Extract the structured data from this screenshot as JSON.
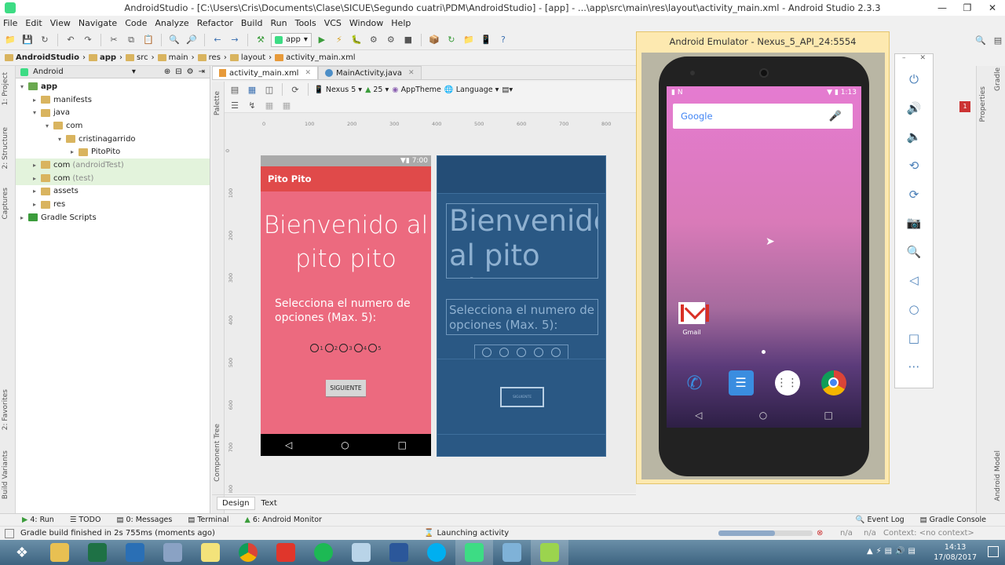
{
  "window": {
    "title": "AndroidStudio - [C:\\Users\\Cris\\Documents\\Clase\\SICUE\\Segundo cuatri\\PDM\\AndroidStudio] - [app] - ...\\app\\src\\main\\res\\layout\\activity_main.xml - Android Studio 2.3.3"
  },
  "menu": [
    "File",
    "Edit",
    "View",
    "Navigate",
    "Code",
    "Analyze",
    "Refactor",
    "Build",
    "Run",
    "Tools",
    "VCS",
    "Window",
    "Help"
  ],
  "toolbar": {
    "run_config": "app"
  },
  "breadcrumb": [
    "AndroidStudio",
    "app",
    "src",
    "main",
    "res",
    "layout",
    "activity_main.xml"
  ],
  "project": {
    "view_mode": "Android",
    "tree": [
      {
        "label": "app",
        "depth": 0,
        "open": true,
        "color": "#6aa84f"
      },
      {
        "label": "manifests",
        "depth": 1,
        "open": false,
        "color": "#d9b45f"
      },
      {
        "label": "java",
        "depth": 1,
        "open": true,
        "color": "#d9b45f"
      },
      {
        "label": "com",
        "depth": 2,
        "open": true,
        "color": "#d9b45f"
      },
      {
        "label": "cristinagarrido",
        "depth": 3,
        "open": true,
        "color": "#d9b45f"
      },
      {
        "label": "PitoPito",
        "depth": 4,
        "open": false,
        "color": "#d9b45f"
      },
      {
        "label": "com",
        "suffix": "(androidTest)",
        "depth": 1,
        "open": false,
        "color": "#d9b45f",
        "sel": true
      },
      {
        "label": "com",
        "suffix": "(test)",
        "depth": 1,
        "open": false,
        "color": "#d9b45f",
        "sel": true
      },
      {
        "label": "assets",
        "depth": 1,
        "open": false,
        "color": "#d9b45f"
      },
      {
        "label": "res",
        "depth": 1,
        "open": false,
        "color": "#d9b45f"
      },
      {
        "label": "Gradle Scripts",
        "depth": 0,
        "open": false,
        "color": "#3b9c3b"
      }
    ]
  },
  "left_tabs": [
    "1: Project",
    "2: Structure",
    "Captures",
    "2: Favorites",
    "Build Variants"
  ],
  "editor_tabs": [
    "activity_main.xml",
    "MainActivity.java"
  ],
  "design_toolbar": {
    "device": "Nexus 5",
    "api": "25",
    "theme": "AppTheme",
    "language": "Language"
  },
  "side_labels": {
    "palette": "Palette",
    "component_tree": "Component Tree",
    "properties": "Properties",
    "gradle": "Gradle",
    "android_model": "Android Model"
  },
  "ruler": {
    "top": [
      "0",
      "100",
      "200",
      "300",
      "400",
      "500",
      "600",
      "700",
      "800"
    ],
    "left": [
      "0",
      "100",
      "200",
      "300",
      "400",
      "500",
      "600",
      "700",
      "800"
    ]
  },
  "preview": {
    "status_time": "7:00",
    "app_title": "Pito Pito",
    "welcome": "Bienvenido al pito pito",
    "question": "Selecciona el numero de opciones (Max. 5):",
    "radios": [
      "1",
      "2",
      "3",
      "4",
      "5"
    ],
    "button": "SIGUIENTE"
  },
  "blueprint": {
    "welcome": "Bienvenido al pito pito",
    "question": "Selecciona el numero de opciones (Max. 5):",
    "button": "SIGUIENTE"
  },
  "bottom_tabs": [
    "Design",
    "Text"
  ],
  "emulator": {
    "title": "Android Emulator - Nexus_5_API_24:5554",
    "time": "1:13",
    "search_brand": "Google",
    "app_label": "Gmail"
  },
  "status_tools": [
    "4: Run",
    "TODO",
    "0: Messages",
    "Terminal",
    "6: Android Monitor",
    "Event Log",
    "Gradle Console"
  ],
  "status_message": "Gradle build finished in 2s 755ms (moments ago)",
  "status_center": "Launching activity",
  "status_right": {
    "a": "n/a",
    "b": "n/a",
    "context": "Context: <no context>"
  },
  "clock": {
    "time": "14:13",
    "date": "17/08/2017"
  },
  "notification_count": "1"
}
